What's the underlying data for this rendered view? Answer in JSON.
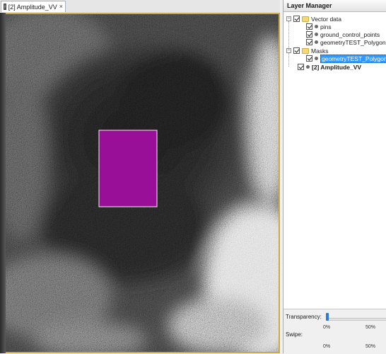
{
  "document_tab": {
    "title": "[2] Amplitude_VV",
    "close_glyph": "×",
    "icon": "image-layer-icon"
  },
  "layer_manager": {
    "title": "Layer Manager",
    "tree": {
      "vector_data": {
        "label": "Vector data",
        "expander": "−",
        "children": [
          "pins",
          "ground_control_points",
          "geometryTEST_Polygon"
        ]
      },
      "masks": {
        "label": "Masks",
        "expander": "−",
        "children": [
          "geometryTEST_Polygon"
        ],
        "selected": "geometryTEST_Polygon"
      },
      "raster_layer": {
        "label": "[2] Amplitude_VV"
      }
    },
    "transparency": {
      "label": "Transparency:",
      "ticks": [
        "0%",
        "50%"
      ],
      "value_percent": 0
    },
    "swipe": {
      "label": "Swipe:",
      "ticks": [
        "0%",
        "50%"
      ]
    }
  },
  "colors": {
    "mask_fill": "#9a0f97",
    "selection": "#3399ff",
    "folder": "#f3d879",
    "frame": "#c9a94a"
  }
}
